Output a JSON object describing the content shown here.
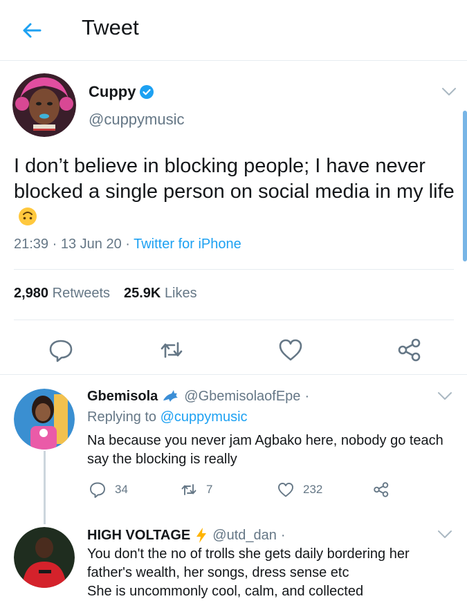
{
  "header": {
    "title": "Tweet"
  },
  "main_tweet": {
    "author_name": "Cuppy",
    "handle": "@cuppymusic",
    "text": "I don’t believe in blocking people; I have never blocked a single person on social media in my life",
    "time": "21:39",
    "date": "13 Jun 20",
    "source": "Twitter for iPhone",
    "retweets_count": "2,980",
    "retweets_label": "Retweets",
    "likes_count": "25.9K",
    "likes_label": "Likes"
  },
  "replies": [
    {
      "name": "Gbemisola",
      "handle": "@GbemisolaofEpe",
      "dot": "·",
      "replying_prefix": "Replying to",
      "replying_to": "@cuppymusic",
      "text": "Na because you never jam Agbako here, nobody go teach say the blocking is really",
      "reply_count": "34",
      "retweet_count": "7",
      "like_count": "232"
    },
    {
      "name": "HIGH VOLTAGE",
      "handle": "@utd_dan",
      "dot": "·",
      "text_lines": [
        "You don't the no of trolls she gets daily bordering her",
        "father's wealth, her songs, dress sense etc",
        "She is uncommonly cool, calm, and collected"
      ]
    }
  ],
  "colors": {
    "accent": "#1da1f2",
    "secondary_text": "#657786",
    "divider": "#e6ecf0",
    "icon_gray": "#657786"
  },
  "icons": {
    "back": "arrow-left-icon",
    "verified": "verified-badge-icon",
    "caret": "chevron-down-icon",
    "reply": "reply-icon",
    "retweet": "retweet-icon",
    "like": "heart-icon",
    "share": "share-icon",
    "emoji": "upside-down-face-icon",
    "dolphin": "dolphin-icon",
    "lightning": "lightning-icon"
  }
}
